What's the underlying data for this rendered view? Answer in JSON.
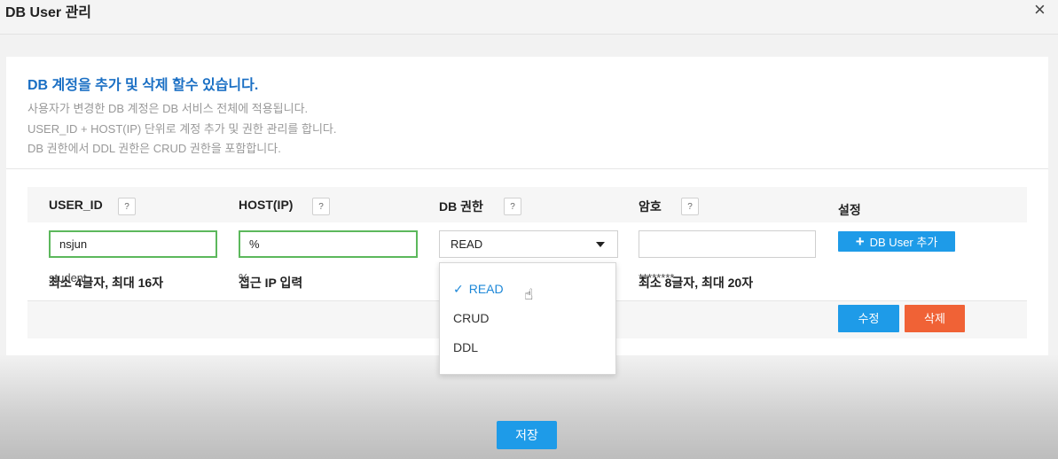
{
  "dialog": {
    "title": "DB User 관리",
    "close": "×"
  },
  "info": {
    "heading": "DB 계정을 추가 및 삭제 할수 있습니다.",
    "lines": [
      "사용자가 변경한 DB 계정은 DB 서비스 전체에 적용됩니다.",
      "USER_ID + HOST(IP) 단위로 계정 추가 및 권한 관리를 합니다.",
      "DB 권한에서 DDL 권한은 CRUD 권한을 포함합니다."
    ]
  },
  "columns": {
    "user_id": "USER_ID",
    "host": "HOST(IP)",
    "privilege": "DB 권한",
    "password": "암호",
    "settings": "설정",
    "help_glyph": "?"
  },
  "form": {
    "user_id_value": "nsjun",
    "host_value": "%",
    "privilege_selected": "READ",
    "password_value": "",
    "add_button": "DB User 추가",
    "add_icon": "+"
  },
  "hints": {
    "user_id": "최소 4글자, 최대 16자",
    "host": "접근 IP 입력",
    "password": "최소 8글자, 최대 20자"
  },
  "users": [
    {
      "user_id": "student",
      "host": "%",
      "password": "********",
      "edit": "수정",
      "delete": "삭제"
    }
  ],
  "dropdown": {
    "check": "✓",
    "options": [
      "READ",
      "CRUD",
      "DDL"
    ],
    "selected": "READ"
  },
  "icons": {
    "help": "question-circle-icon",
    "close": "close-icon",
    "plus": "plus-icon",
    "cursor": "hand-pointer-cursor-icon"
  },
  "colors": {
    "accent": "#1e9be8",
    "danger": "#f06236",
    "heading": "#1a6fc4",
    "valid_border": "#5cb85c"
  },
  "footer": {
    "save": "저장"
  }
}
